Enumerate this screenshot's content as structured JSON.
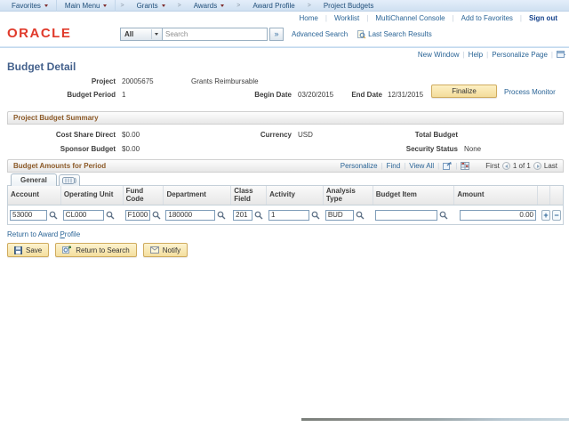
{
  "breadcrumb": {
    "favorites": "Favorites",
    "main_menu": "Main Menu",
    "path": [
      "Grants",
      "Awards",
      "Award Profile",
      "Project Budgets"
    ],
    "sep": ">"
  },
  "header_links": {
    "items": [
      "Home",
      "Worklist",
      "MultiChannel Console",
      "Add to Favorites"
    ],
    "sign_out": "Sign out",
    "divider": "|"
  },
  "brand": {
    "logo": "ORACLE"
  },
  "search": {
    "scope": "All",
    "placeholder": "Search",
    "go": "»",
    "advanced": "Advanced Search",
    "last_results": "Last Search Results"
  },
  "utility": {
    "items": [
      "New Window",
      "Help",
      "Personalize Page"
    ],
    "divider": "|"
  },
  "page": {
    "title": "Budget Detail"
  },
  "project": {
    "label": "Project",
    "id": "20005675",
    "description": "Grants Reimbursable",
    "budget_period_label": "Budget Period",
    "budget_period": "1",
    "begin_date_label": "Begin Date",
    "begin_date": "03/20/2015",
    "end_date_label": "End Date",
    "end_date": "12/31/2015",
    "finalize": "Finalize",
    "process_monitor": "Process Monitor"
  },
  "summary": {
    "title": "Project Budget Summary",
    "cost_share_label": "Cost Share Direct",
    "cost_share": "$0.00",
    "sponsor_label": "Sponsor Budget",
    "sponsor": "$0.00",
    "currency_label": "Currency",
    "currency": "USD",
    "total_label": "Total Budget",
    "total": "",
    "security_label": "Security Status",
    "security": "None"
  },
  "amounts": {
    "title": "Budget Amounts for Period",
    "personalize": "Personalize",
    "find": "Find",
    "view_all": "View All",
    "divider": "|",
    "pager": {
      "first": "First",
      "count": "1 of 1",
      "last": "Last"
    },
    "tab": "General"
  },
  "grid": {
    "columns": [
      "Account",
      "Operating Unit",
      "Fund Code",
      "Department",
      "Class Field",
      "Activity",
      "Analysis Type",
      "Budget Item",
      "Amount"
    ],
    "row": {
      "account": "53000",
      "operating_unit": "CL000",
      "fund_code": "F1000",
      "department": "180000",
      "class_field": "201",
      "activity": "1",
      "analysis_type": "BUD",
      "budget_item": "",
      "amount": "0.00"
    },
    "add": "+",
    "remove": "−"
  },
  "footer": {
    "return_pre": "Return to Award ",
    "return_p": "P",
    "return_post": "rofile",
    "save": "Save",
    "return_to_search": "Return to Search",
    "notify": "Notify"
  }
}
